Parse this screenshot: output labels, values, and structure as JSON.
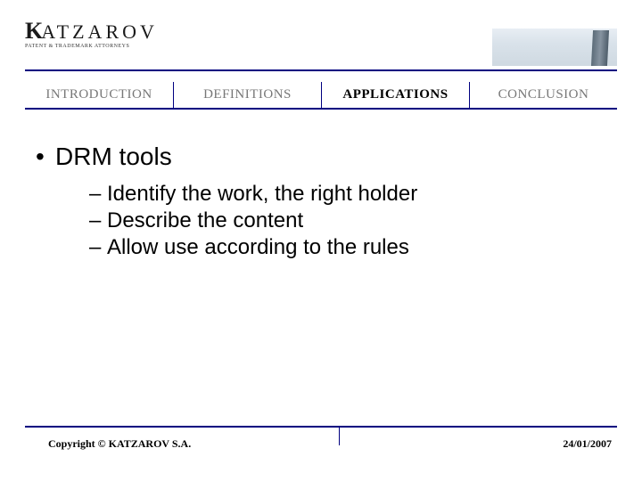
{
  "header": {
    "logo_text": "ATZAROV",
    "logo_first": "K",
    "logo_sub": "PATENT & TRADEMARK ATTORNEYS"
  },
  "nav": {
    "items": [
      {
        "label": "INTRODUCTION",
        "active": false
      },
      {
        "label": "DEFINITIONS",
        "active": false
      },
      {
        "label": "APPLICATIONS",
        "active": true
      },
      {
        "label": "CONCLUSION",
        "active": false
      }
    ]
  },
  "content": {
    "bullet": "DRM tools",
    "subs": [
      "Identify the work, the right holder",
      "Describe the content",
      "Allow use according to the rules"
    ]
  },
  "footer": {
    "copyright": "Copyright © KATZAROV S.A.",
    "date": "24/01/2007"
  }
}
